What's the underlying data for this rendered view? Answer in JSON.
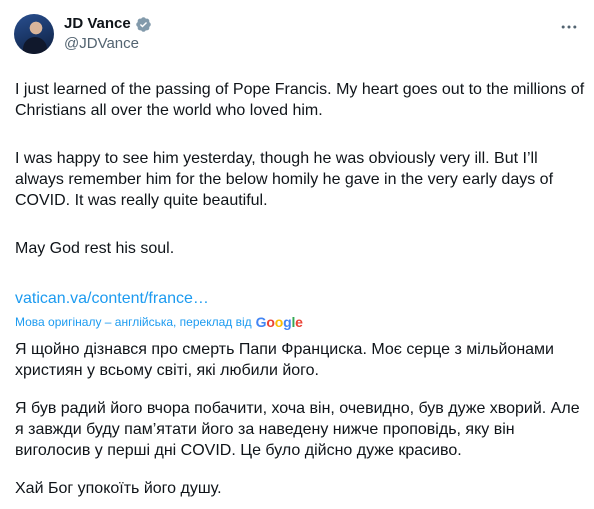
{
  "post": {
    "author": {
      "display_name": "JD Vance",
      "handle": "@JDVance",
      "verified": true,
      "avatar_icon": "avatar-photo"
    },
    "more_icon": "more-horizontal-icon",
    "paragraphs": [
      "I just learned of the passing of Pope Francis. My heart goes out to the millions of Christians all over the world who loved him.",
      "I was happy to see him yesterday, though he was obviously very ill. But I’ll always remember him for the below homily he gave in the very early days of COVID. It was really quite beautiful.",
      "May God rest his soul."
    ],
    "link_text": "vatican.va/content/france…",
    "translation_notice": "Мова оригіналу – англійська, переклад від",
    "translation_provider": "Google",
    "translated_paragraphs": [
      "Я щойно дізнався про смерть Папи Франциска. Моє серце з мільйонами християн у всьому світі, які любили його.",
      "Я був радий його вчора побачити, хоча він, очевидно, був дуже хворий. Але я завжди буду пам’ятати його за наведену нижче проповідь, яку він виголосив у перші дні COVID. Це було дійсно дуже красиво.",
      "Хай Бог упокоїть його душу."
    ]
  },
  "colors": {
    "text_primary": "#0f1419",
    "text_secondary": "#536471",
    "link": "#1d9bf0",
    "verified_badge": "#1d9bf0"
  }
}
